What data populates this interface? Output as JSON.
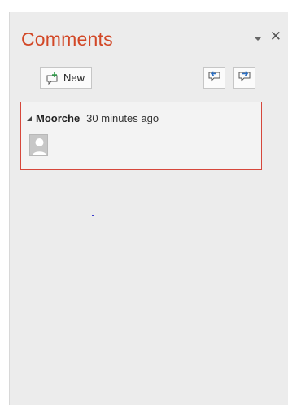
{
  "pane": {
    "title": "Comments",
    "dropdown_icon": "chevron-down-icon",
    "close_icon": "close-icon",
    "close_glyph": "✕"
  },
  "toolbar": {
    "new_label": "New",
    "new_icon": "new-comment-icon",
    "previous_icon": "previous-comment-icon",
    "next_icon": "next-comment-icon"
  },
  "comments": [
    {
      "author": "Moorche",
      "time": "30 minutes ago",
      "avatar_icon": "user-avatar-icon"
    }
  ],
  "colors": {
    "accent": "#d24726",
    "selected_border": "#d6473b",
    "pane_background": "#ececec"
  }
}
